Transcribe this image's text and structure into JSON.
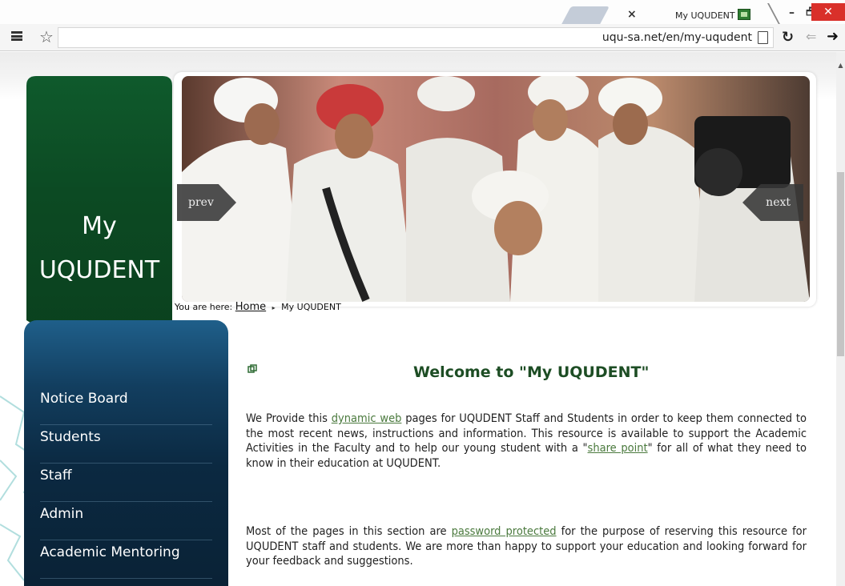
{
  "browser": {
    "tab_title": "My UQUDENT",
    "tab_close": "×",
    "url": "uqu-sa.net/en/my-uqudent",
    "window_controls": {
      "minimize": "–",
      "maximize": "🗗",
      "close": "✕"
    },
    "icons": [
      "menu-icon",
      "bookmark-star-icon",
      "page-icon",
      "reload-icon",
      "back-icon",
      "forward-icon"
    ]
  },
  "logo": {
    "line1": "My",
    "line2": "UQUDENT"
  },
  "slider": {
    "prev_label": "prev",
    "next_label": "next"
  },
  "breadcrumb": {
    "prefix": "You are here:",
    "home": "Home",
    "current": "My UQUDENT"
  },
  "sidebar": {
    "items": [
      {
        "label": "Notice Board"
      },
      {
        "label": "Students"
      },
      {
        "label": "Staff"
      },
      {
        "label": "Admin"
      },
      {
        "label": "Academic Mentoring"
      }
    ]
  },
  "main": {
    "title": "Welcome to \"My UQUDENT\"",
    "p1": {
      "t1": "We Provide this ",
      "link1": "dynamic web",
      "t2": " pages for UQUDENT Staff and Students in order to keep them connected to the most recent news, instructions and information. This resource is available to support the Academic Activities in the Faculty and to help our young student with a \"",
      "link2": "share point",
      "t3": "\" for all of what they need to know in their education at UQUDENT."
    },
    "p2": {
      "t1": "Most of the pages in this section are ",
      "link1": "password protected",
      "t2": " for the purpose of reserving this resource for UQUDENT staff and students. We are more than happy to support your education and looking forward for your feedback and suggestions."
    }
  },
  "colors": {
    "brand_green": "#0e4d25",
    "nav_blue": "#0b2941",
    "link_green": "#4b7a3e",
    "close_red": "#d9302a"
  }
}
